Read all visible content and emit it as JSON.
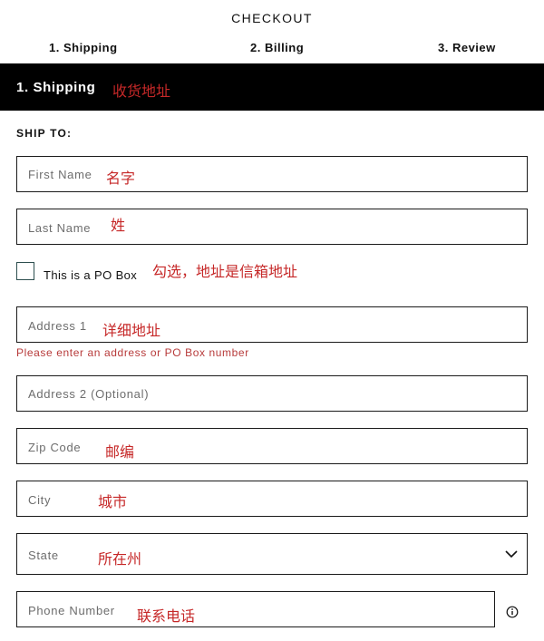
{
  "header": {
    "title": "CHECKOUT",
    "steps": [
      "1. Shipping",
      "2. Billing",
      "3. Review"
    ]
  },
  "section": {
    "title": "1. Shipping",
    "annotation": "收货地址"
  },
  "ship_to_label": "SHIP TO:",
  "fields": {
    "first_name": {
      "placeholder": "First Name",
      "annotation": "名字"
    },
    "last_name": {
      "placeholder": "Last Name",
      "annotation": "姓"
    },
    "address1": {
      "placeholder": "Address 1",
      "annotation": "详细地址"
    },
    "address2": {
      "placeholder": "Address 2 (Optional)"
    },
    "zip": {
      "placeholder": "Zip Code",
      "annotation": "邮编"
    },
    "city": {
      "placeholder": "City",
      "annotation": "城市"
    },
    "state": {
      "placeholder": "State",
      "annotation": "所在州"
    },
    "phone": {
      "placeholder": "Phone Number",
      "annotation": "联系电话"
    }
  },
  "po_box": {
    "label": "This is a PO Box",
    "annotation": "勾选，地址是信箱地址",
    "checked": false
  },
  "errors": {
    "address1": "Please enter an address or PO Box number"
  },
  "icons": {
    "state_dropdown": "chevron-down-icon",
    "phone_info": "info-icon"
  },
  "colors": {
    "section_bar": "#000000",
    "annotation": "#c62828",
    "error_text": "#b73a3a"
  }
}
